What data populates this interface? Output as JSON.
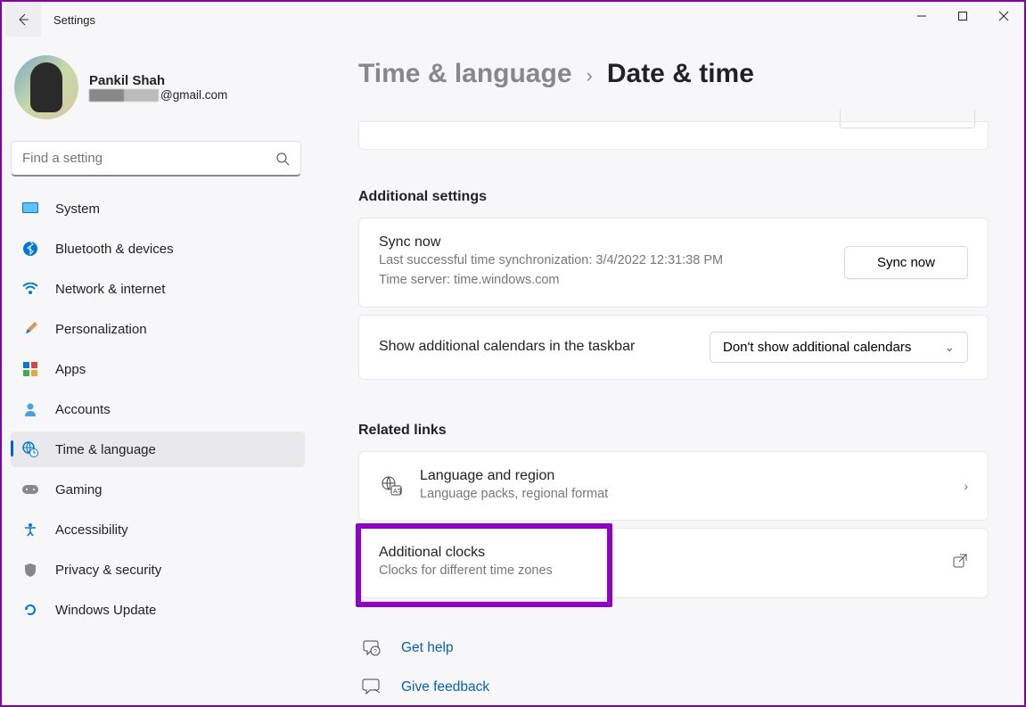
{
  "app_title": "Settings",
  "user": {
    "name": "Pankil Shah",
    "email_domain": "@gmail.com"
  },
  "search": {
    "placeholder": "Find a setting"
  },
  "nav": {
    "items": [
      {
        "label": "System"
      },
      {
        "label": "Bluetooth & devices"
      },
      {
        "label": "Network & internet"
      },
      {
        "label": "Personalization"
      },
      {
        "label": "Apps"
      },
      {
        "label": "Accounts"
      },
      {
        "label": "Time & language"
      },
      {
        "label": "Gaming"
      },
      {
        "label": "Accessibility"
      },
      {
        "label": "Privacy & security"
      },
      {
        "label": "Windows Update"
      }
    ],
    "active_index": 6
  },
  "breadcrumb": {
    "parent": "Time & language",
    "current": "Date & time"
  },
  "sections": {
    "additional_settings_title": "Additional settings",
    "related_links_title": "Related links"
  },
  "sync": {
    "title": "Sync now",
    "last_sync_line": "Last successful time synchronization: 3/4/2022 12:31:38 PM",
    "server_line": "Time server: time.windows.com",
    "button_label": "Sync now"
  },
  "calendars": {
    "label": "Show additional calendars in the taskbar",
    "selected": "Don't show additional calendars"
  },
  "related": {
    "lang_region": {
      "title": "Language and region",
      "sub": "Language packs, regional format"
    },
    "additional_clocks": {
      "title": "Additional clocks",
      "sub": "Clocks for different time zones"
    }
  },
  "footer_links": {
    "get_help": "Get help",
    "give_feedback": "Give feedback"
  }
}
